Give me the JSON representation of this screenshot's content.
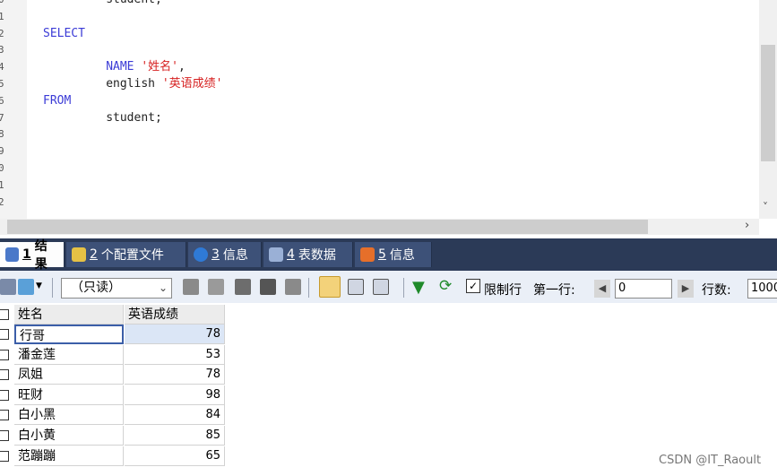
{
  "editor": {
    "line_numbers": [
      "0",
      "1",
      "2",
      "3",
      "4",
      "5",
      "6",
      "7",
      "8",
      "9",
      "0",
      "1",
      "2"
    ],
    "lines": [
      {
        "parts": [
          {
            "t": "plain",
            "v": "student;"
          }
        ],
        "indent": 9
      },
      {
        "parts": [],
        "indent": 0
      },
      {
        "parts": [
          {
            "t": "kw",
            "v": "SELECT"
          }
        ],
        "indent": 0
      },
      {
        "parts": [],
        "indent": 0
      },
      {
        "parts": [
          {
            "t": "kw",
            "v": "NAME"
          },
          {
            "t": "plain",
            "v": " "
          },
          {
            "t": "str",
            "v": "'姓名'"
          },
          {
            "t": "plain",
            "v": ","
          }
        ],
        "indent": 9
      },
      {
        "parts": [
          {
            "t": "plain",
            "v": "english "
          },
          {
            "t": "str",
            "v": "'英语成绩'"
          }
        ],
        "indent": 9
      },
      {
        "parts": [
          {
            "t": "kw",
            "v": "FROM"
          }
        ],
        "indent": 0
      },
      {
        "parts": [
          {
            "t": "plain",
            "v": "student;"
          }
        ],
        "indent": 9
      }
    ],
    "vscroll_down_glyph": "˅",
    "hscroll_right_glyph": "›"
  },
  "tabs": [
    {
      "num": "1",
      "label": "结果",
      "icon": "grid-icon",
      "color": "#4a78c9"
    },
    {
      "num": "2",
      "label": "个配置文件",
      "icon": "profile-icon",
      "color": "#e5c145"
    },
    {
      "num": "3",
      "label": "信息",
      "icon": "info-icon",
      "color": "#2f7ad6"
    },
    {
      "num": "4",
      "label": "表数据",
      "icon": "table-icon",
      "color": "#9ab0d6"
    },
    {
      "num": "5",
      "label": "信息",
      "icon": "info-multi-icon",
      "color": "#e66f2a"
    }
  ],
  "toolbar": {
    "readonly_select": "（只读）",
    "limit_label": "限制行",
    "first_row_label": "第一行:",
    "first_row_value": "0",
    "rows_label": "行数:",
    "rows_value": "1000"
  },
  "grid": {
    "columns": [
      "姓名",
      "英语成绩"
    ],
    "rows": [
      [
        "行哥",
        "78"
      ],
      [
        "潘金莲",
        "53"
      ],
      [
        "凤姐",
        "78"
      ],
      [
        "旺财",
        "98"
      ],
      [
        "白小黑",
        "84"
      ],
      [
        "白小黄",
        "85"
      ],
      [
        "范蹦蹦",
        "65"
      ]
    ]
  },
  "watermark": "CSDN @IT_Raoult"
}
